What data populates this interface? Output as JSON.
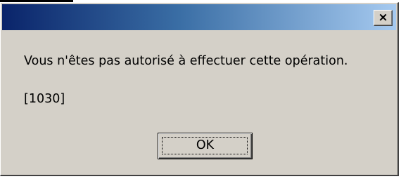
{
  "dialog": {
    "close_label": "×",
    "message": "Vous n'êtes pas autorisé à effectuer cette opération.",
    "code": "[1030]",
    "ok_label": "OK"
  },
  "colors": {
    "face": "#d4d0c8",
    "title_start": "#0a246a",
    "title_end": "#a6caf0"
  },
  "icons": [
    "close-icon"
  ]
}
